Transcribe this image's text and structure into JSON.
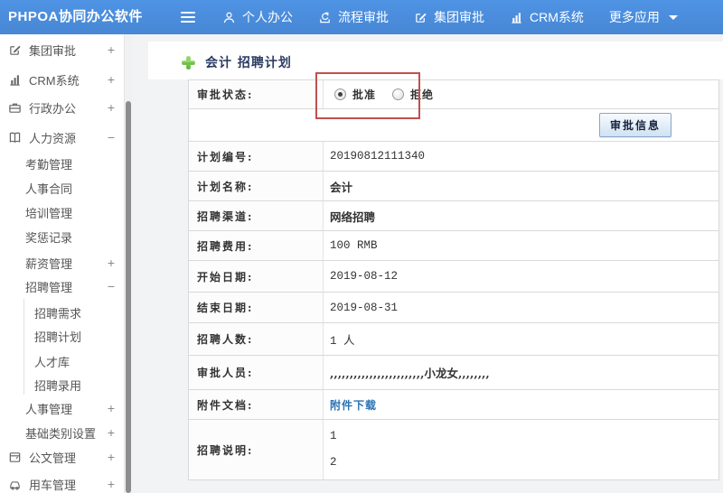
{
  "header": {
    "app_title": "PHPOA协同办公软件",
    "nav": [
      {
        "name": "personal-office",
        "label": "个人办公",
        "icon": "user-icon"
      },
      {
        "name": "workflow-approval",
        "label": "流程审批",
        "icon": "workflow-icon"
      },
      {
        "name": "group-approval",
        "label": "集团审批",
        "icon": "edit-icon"
      },
      {
        "name": "crm-system",
        "label": "CRM系统",
        "icon": "chart-icon"
      },
      {
        "name": "more-apps",
        "label": "更多应用",
        "icon": "",
        "caret": true
      }
    ]
  },
  "sidebar": {
    "items": [
      {
        "name": "group-approval",
        "label": "集团审批",
        "icon": "edit-icon",
        "level": 0,
        "expander": "+"
      },
      {
        "name": "crm-system",
        "label": "CRM系统",
        "icon": "chart-icon",
        "level": 0,
        "expander": "+"
      },
      {
        "name": "admin-office",
        "label": "行政办公",
        "icon": "briefcase-icon",
        "level": 0,
        "expander": "+"
      },
      {
        "name": "human-resources",
        "label": "人力资源",
        "icon": "book-icon",
        "level": 0,
        "expander": "−"
      },
      {
        "name": "attendance-mgmt",
        "label": "考勤管理",
        "level": 1
      },
      {
        "name": "hr-contracts",
        "label": "人事合同",
        "level": 1
      },
      {
        "name": "training-mgmt",
        "label": "培训管理",
        "level": 1
      },
      {
        "name": "reward-punish-records",
        "label": "奖惩记录",
        "level": 1
      },
      {
        "name": "salary-mgmt",
        "label": "薪资管理",
        "level": 1,
        "expander": "+"
      },
      {
        "name": "recruit-mgmt",
        "label": "招聘管理",
        "level": 1,
        "expander": "−"
      },
      {
        "name": "recruit-demand",
        "label": "招聘需求",
        "level": 2
      },
      {
        "name": "recruit-plan",
        "label": "招聘计划",
        "level": 2
      },
      {
        "name": "talent-pool",
        "label": "人才库",
        "level": 2
      },
      {
        "name": "recruit-hire",
        "label": "招聘录用",
        "level": 2
      },
      {
        "name": "personnel-mgmt",
        "label": "人事管理",
        "level": 1,
        "expander": "+"
      },
      {
        "name": "base-category-settings",
        "label": "基础类别设置",
        "level": 1,
        "expander": "+"
      },
      {
        "name": "document-mgmt",
        "label": "公文管理",
        "icon": "doc-icon",
        "level": 0,
        "expander": "+"
      },
      {
        "name": "vehicle-mgmt",
        "label": "用车管理",
        "icon": "car-icon",
        "level": 0,
        "expander": "+"
      }
    ]
  },
  "main": {
    "page_title": "会计 招聘计划",
    "approval": {
      "label": "审批状态:",
      "options": [
        {
          "label": "批准",
          "selected": true
        },
        {
          "label": "拒绝",
          "selected": false
        }
      ],
      "button_label": "审批信息"
    },
    "rows": [
      {
        "label": "计划编号:",
        "value": "20190812111340"
      },
      {
        "label": "计划名称:",
        "value": "会计"
      },
      {
        "label": "招聘渠道:",
        "value": "网络招聘"
      },
      {
        "label": "招聘费用:",
        "value": "100 RMB"
      },
      {
        "label": "开始日期:",
        "value": "2019-08-12"
      },
      {
        "label": "结束日期:",
        "value": "2019-08-31"
      },
      {
        "label": "招聘人数:",
        "value": "1 人"
      },
      {
        "label": "审批人员:",
        "value": ",,,,,,,,,,,,,,,,,,,,,,,,小龙女,,,,,,,,"
      },
      {
        "label": "附件文档:",
        "value": "附件下载"
      },
      {
        "label": "招聘说明:",
        "value": "1\n2"
      }
    ],
    "colors": {
      "header_blue": "#4a8cda",
      "annotation_red": "#c0504d",
      "link_blue": "#2a72b5",
      "plus_green": "#55b42c"
    }
  }
}
